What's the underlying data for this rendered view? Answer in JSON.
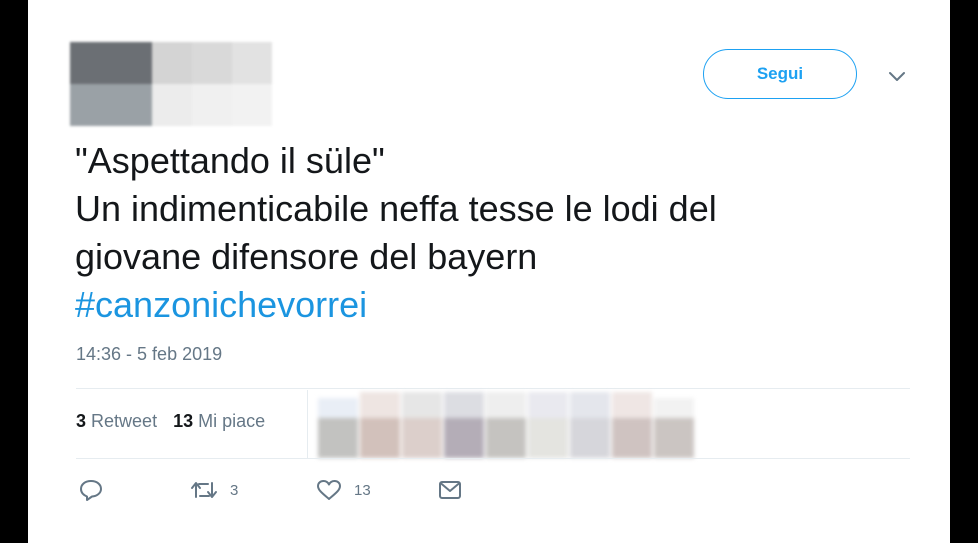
{
  "header": {
    "follow_label": "Segui"
  },
  "tweet": {
    "lines": [
      "\"Aspettando il süle\"",
      "Un indimenticabile neffa tesse le lodi del",
      "giovane difensore del bayern"
    ],
    "hashtag": "#canzonichevorrei",
    "timestamp": "14:36 - 5 feb 2019"
  },
  "stats": {
    "retweets_count": "3",
    "retweets_label": "Retweet",
    "likes_count": "13",
    "likes_label": "Mi piace"
  },
  "actions": {
    "reply_icon": "reply-icon",
    "retweet_icon": "retweet-icon",
    "retweet_count": "3",
    "like_icon": "heart-icon",
    "like_count": "13",
    "dm_icon": "envelope-icon"
  },
  "colors": {
    "accent": "#1da1f2",
    "hashtag": "#1b95e0",
    "muted": "#657786",
    "text": "#14171a"
  }
}
